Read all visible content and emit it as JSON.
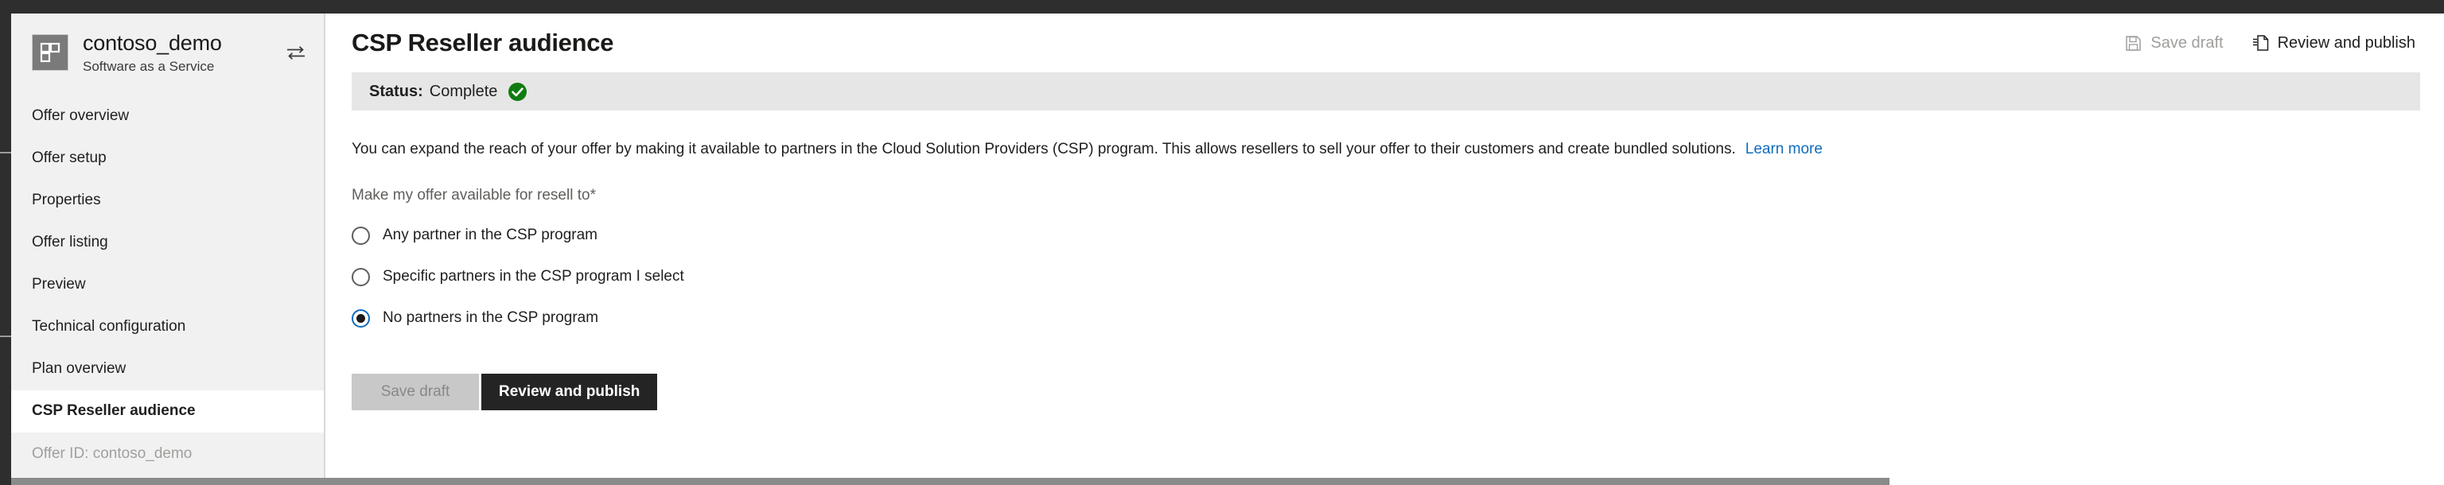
{
  "offer": {
    "name": "contoso_demo",
    "type": "Software as a Service",
    "logo_icon": "grid-squares-icon",
    "swap_icon": "swap-arrows-icon",
    "offer_id_label": "Offer ID: contoso_demo"
  },
  "sidebar": {
    "items": [
      {
        "label": "Offer overview",
        "selected": false
      },
      {
        "label": "Offer setup",
        "selected": false
      },
      {
        "label": "Properties",
        "selected": false
      },
      {
        "label": "Offer listing",
        "selected": false
      },
      {
        "label": "Preview",
        "selected": false
      },
      {
        "label": "Technical configuration",
        "selected": false
      },
      {
        "label": "Plan overview",
        "selected": false
      },
      {
        "label": "CSP Reseller audience",
        "selected": true
      }
    ]
  },
  "header": {
    "title": "CSP Reseller audience",
    "actions": [
      {
        "label": "Save draft",
        "icon": "save-disk-icon",
        "enabled": false
      },
      {
        "label": "Review and publish",
        "icon": "publish-document-icon",
        "enabled": true
      }
    ]
  },
  "status": {
    "label": "Status:",
    "value": "Complete",
    "icon": "green-check-circle-icon",
    "color": "#107c10"
  },
  "main": {
    "description": "You can expand the reach of your offer by making it available to partners in the Cloud Solution Providers (CSP) program. This allows resellers to sell your offer to their customers and create bundled solutions.",
    "learn_more_label": "Learn more",
    "field_label": "Make my offer available for resell to",
    "required_marker": "*",
    "radio_options": [
      {
        "label": "Any partner in the CSP program",
        "checked": false
      },
      {
        "label": "Specific partners in the CSP program I select",
        "checked": false
      },
      {
        "label": "No partners in the CSP program",
        "checked": true
      }
    ]
  },
  "footer": {
    "save_draft_label": "Save draft",
    "review_publish_label": "Review and publish"
  },
  "colors": {
    "accent": "#0f6cbd",
    "link": "#0f6cbd",
    "success": "#107c10",
    "primary_button_bg": "#242424",
    "chrome": "#2e2e2e"
  }
}
